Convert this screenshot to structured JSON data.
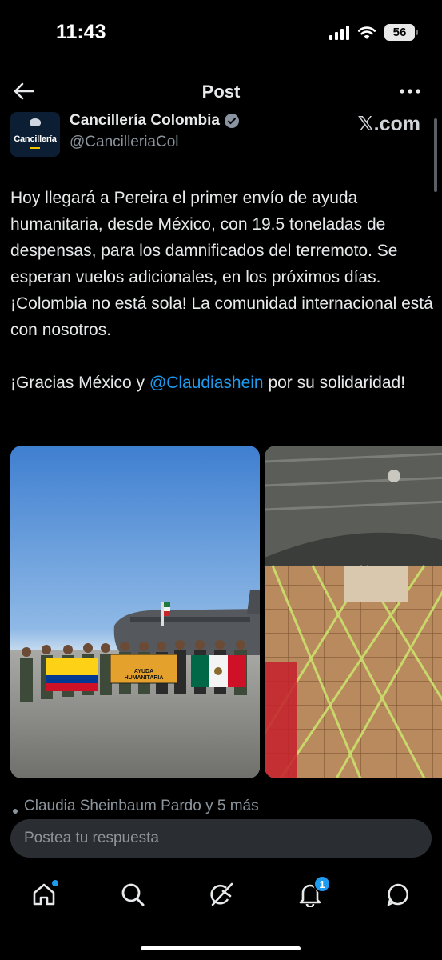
{
  "status_bar": {
    "time": "11:43",
    "battery": "56"
  },
  "header": {
    "title": "Post"
  },
  "card": {
    "name": "Cancillería Colombia",
    "handle": "@CancilleriaCol",
    "avatar_label": "Cancillería",
    "brand": "𝕏.com"
  },
  "post": {
    "paragraph1": "Hoy llegará a Pereira el primer envío de ayuda humanitaria, desde México, con 19.5 toneladas de despensas, para los damnificados del terremoto. Se esperan vuelos adicionales, en los próximos días. ¡Colombia no está sola! La comunidad internacional está con nosotros.",
    "paragraph2_before": "¡Gracias México y ",
    "mention": "@Claudiashein",
    "paragraph2_after": " por su solidaridad!"
  },
  "photos": {
    "left_banner_line1": "AYUDA",
    "left_banner_line2": "HUMANITARIA"
  },
  "liked_by": "Claudia Sheinbaum Pardo y 5 más",
  "reply": {
    "placeholder": "Postea tu respuesta"
  },
  "tabbar": {
    "items": [
      "home-icon",
      "search-icon",
      "grok-icon",
      "notifications-icon",
      "messages-icon"
    ],
    "notification_count": "1"
  },
  "colors": {
    "accent": "#1d9bf0",
    "background": "#000000",
    "reply_bg": "#2a2d31"
  }
}
